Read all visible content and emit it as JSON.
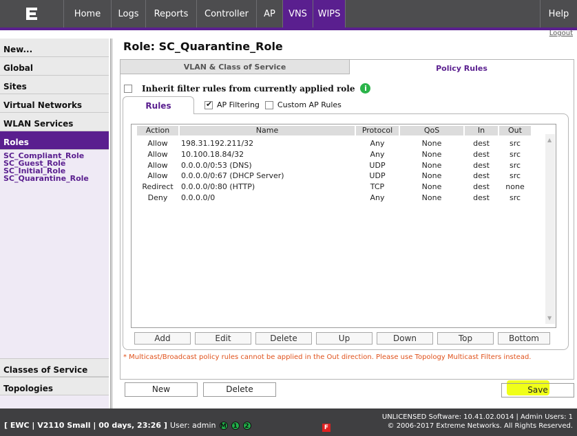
{
  "nav": {
    "tabs": [
      {
        "label": "Home"
      },
      {
        "label": "Logs"
      },
      {
        "label": "Reports"
      },
      {
        "label": "Controller"
      },
      {
        "label": "AP"
      },
      {
        "label": "VNS"
      },
      {
        "label": "WIPS"
      }
    ],
    "help": "Help",
    "logout": "Logout"
  },
  "sidebar": {
    "items": [
      "New...",
      "Global",
      "Sites",
      "Virtual Networks",
      "WLAN Services",
      "Roles"
    ],
    "roles": [
      "SC_Compliant_Role",
      "SC_Guest_Role",
      "SC_Initial_Role",
      "SC_Quarantine_Role"
    ],
    "bottom": [
      "Classes of Service",
      "Topologies"
    ]
  },
  "page": {
    "title": "Role: SC_Quarantine_Role",
    "tab_vlan": "VLAN & Class of Service",
    "tab_policy": "Policy Rules",
    "inherit_label": "Inherit filter rules from currently applied role",
    "info_icon": "i",
    "rules_tab": "Rules",
    "ap_filtering": "AP Filtering",
    "custom_ap_rules": "Custom AP Rules",
    "ap_filtering_checked": true,
    "custom_ap_rules_checked": false,
    "inherit_checked": false
  },
  "table": {
    "columns": [
      "Action",
      "Name",
      "Protocol",
      "QoS",
      "In",
      "Out"
    ],
    "rows": [
      [
        "Allow",
        "198.31.192.211/32",
        "Any",
        "None",
        "dest",
        "src"
      ],
      [
        "Allow",
        "10.100.18.84/32",
        "Any",
        "None",
        "dest",
        "src"
      ],
      [
        "Allow",
        "0.0.0.0/0:53 (DNS)",
        "UDP",
        "None",
        "dest",
        "src"
      ],
      [
        "Allow",
        "0.0.0.0/0:67 (DHCP Server)",
        "UDP",
        "None",
        "dest",
        "src"
      ],
      [
        "Redirect",
        "0.0.0.0/0:80 (HTTP)",
        "TCP",
        "None",
        "dest",
        "none"
      ],
      [
        "Deny",
        "0.0.0.0/0",
        "Any",
        "None",
        "dest",
        "src"
      ]
    ]
  },
  "buttons": {
    "row": [
      "Add",
      "Edit",
      "Delete",
      "Up",
      "Down",
      "Top",
      "Bottom"
    ],
    "new": "New",
    "delete": "Delete",
    "save": "Save"
  },
  "note": "* Multicast/Broadcast policy rules cannot be applied in the Out direction. Please use Topology Multicast Filters instead.",
  "footer": {
    "status": "[ EWC | V2110 Small | 00 days, 23:26 ]",
    "user": "User: admin",
    "indicators": [
      "M",
      "1",
      "2"
    ],
    "flag": "F",
    "license": "UNLICENSED Software: 10.41.02.0014 | Admin Users: 1",
    "copyright": "© 2006-2017  Extreme Networks. All Rights Reserved."
  },
  "colors": {
    "accent": "#5a1f8f",
    "nav_bg": "#4d4d4f",
    "note_text": "#e0511b",
    "save_highlight": "#f0ff19"
  }
}
